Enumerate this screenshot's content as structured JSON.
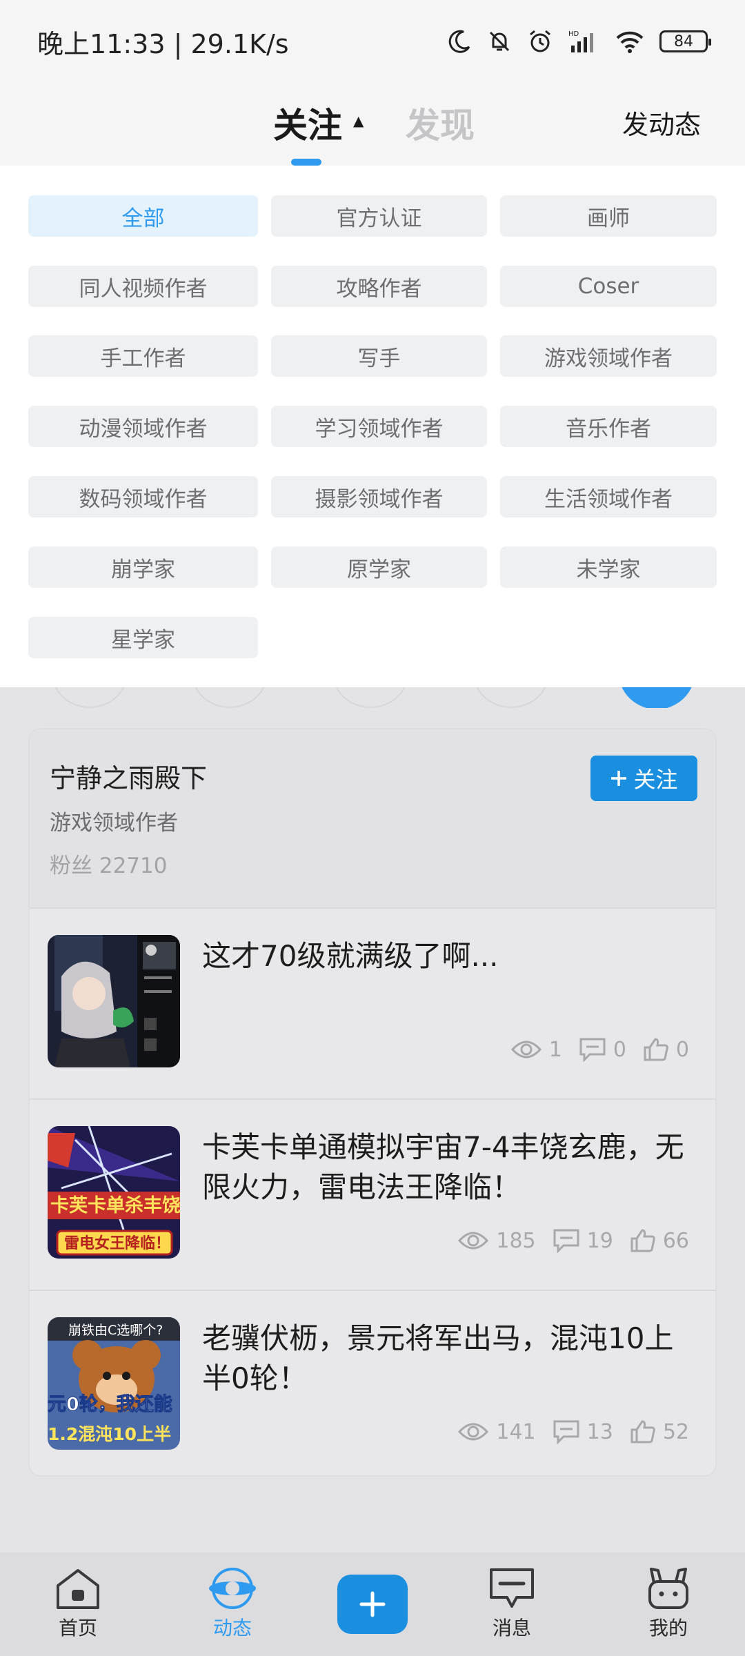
{
  "status_bar": {
    "time_speed": "晚上11:33 | 29.1K/s",
    "battery": "84"
  },
  "header": {
    "tab_follow": "关注",
    "tab_discover": "发现",
    "post_button": "发动态"
  },
  "filters": [
    {
      "label": "全部",
      "active": true
    },
    {
      "label": "官方认证"
    },
    {
      "label": "画师"
    },
    {
      "label": "同人视频作者"
    },
    {
      "label": "攻略作者"
    },
    {
      "label": "Coser"
    },
    {
      "label": "手工作者"
    },
    {
      "label": "写手"
    },
    {
      "label": "游戏领域作者"
    },
    {
      "label": "动漫领域作者"
    },
    {
      "label": "学习领域作者"
    },
    {
      "label": "音乐作者"
    },
    {
      "label": "数码领域作者"
    },
    {
      "label": "摄影领域作者"
    },
    {
      "label": "生活领域作者"
    },
    {
      "label": "崩学家"
    },
    {
      "label": "原学家"
    },
    {
      "label": "未学家"
    },
    {
      "label": "星学家"
    }
  ],
  "author_card": {
    "name": "宁静之雨殿下",
    "tag": "游戏领域作者",
    "fans": "粉丝 22710",
    "follow_label": "关注"
  },
  "posts": [
    {
      "title": "这才70级就满级了啊...",
      "views": "1",
      "comments": "0",
      "likes": "0"
    },
    {
      "title": "卡芙卡单通模拟宇宙7-4丰饶玄鹿，无限火力，雷电法王降临！",
      "views": "185",
      "comments": "19",
      "likes": "66"
    },
    {
      "title": "老骥伏枥，景元将军出马，混沌10上半0轮！",
      "views": "141",
      "comments": "13",
      "likes": "52"
    }
  ],
  "thumb_text": {
    "post2_top": "卡芙卡单杀丰饶玄",
    "post2_bottom": "雷电女王降临！",
    "post3_top": "崩铁由C选哪个?",
    "post3_mid": "元0轮，我还能",
    "post3_bottom": "1.2混沌10上半"
  },
  "bottom_nav": {
    "home": "首页",
    "feed": "动态",
    "messages": "消息",
    "mine": "我的"
  },
  "colors": {
    "accent": "#2e9bf0",
    "follow_button": "#1a8fe0"
  }
}
